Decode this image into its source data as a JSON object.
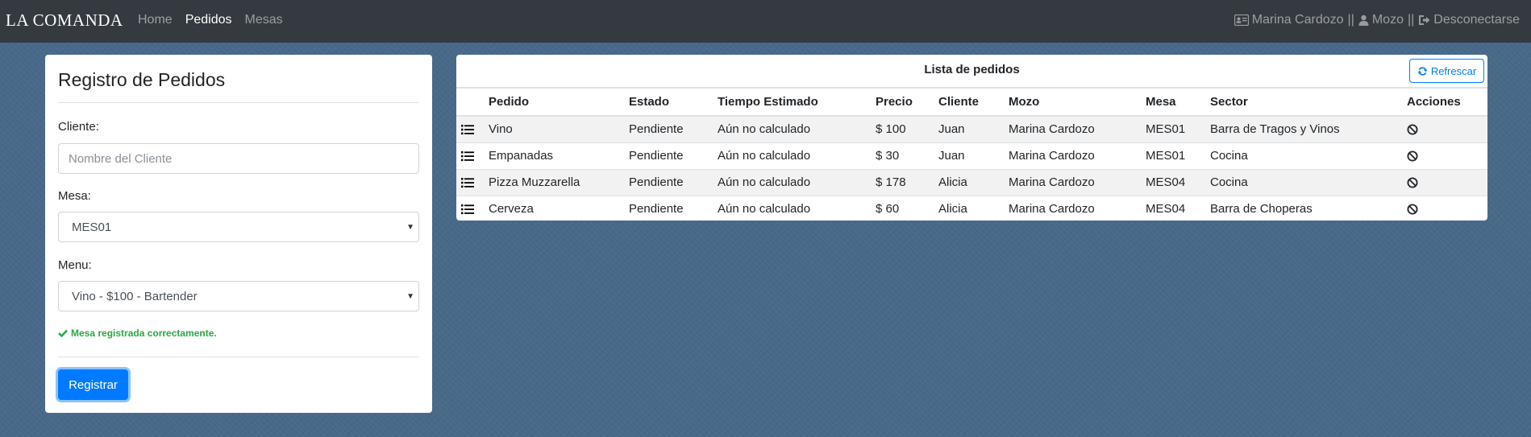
{
  "navbar": {
    "brand": "LA COMANDA",
    "links": [
      {
        "label": "Home",
        "active": false
      },
      {
        "label": "Pedidos",
        "active": true
      },
      {
        "label": "Mesas",
        "active": false
      }
    ],
    "user_name": "Marina Cardozo",
    "separator": "||",
    "role": "Mozo",
    "logout": "Desconectarse"
  },
  "form": {
    "title": "Registro de Pedidos",
    "cliente_label": "Cliente:",
    "cliente_placeholder": "Nombre del Cliente",
    "cliente_value": "",
    "mesa_label": "Mesa:",
    "mesa_value": "MES01",
    "menu_label": "Menu:",
    "menu_value": "Vino - $100 - Bartender",
    "success_message": "Mesa registrada correctamente.",
    "submit_label": "Registrar"
  },
  "orders": {
    "title": "Lista de pedidos",
    "refresh_label": "Refrescar",
    "headers": [
      "Pedido",
      "Estado",
      "Tiempo Estimado",
      "Precio",
      "Cliente",
      "Mozo",
      "Mesa",
      "Sector",
      "Acciones"
    ],
    "rows": [
      {
        "pedido": "Vino",
        "estado": "Pendiente",
        "tiempo": "Aún no calculado",
        "precio": "$ 100",
        "cliente": "Juan",
        "mozo": "Marina Cardozo",
        "mesa": "MES01",
        "sector": "Barra de Tragos y Vinos"
      },
      {
        "pedido": "Empanadas",
        "estado": "Pendiente",
        "tiempo": "Aún no calculado",
        "precio": "$ 30",
        "cliente": "Juan",
        "mozo": "Marina Cardozo",
        "mesa": "MES01",
        "sector": "Cocina"
      },
      {
        "pedido": "Pizza Muzzarella",
        "estado": "Pendiente",
        "tiempo": "Aún no calculado",
        "precio": "$ 178",
        "cliente": "Alicia",
        "mozo": "Marina Cardozo",
        "mesa": "MES04",
        "sector": "Cocina"
      },
      {
        "pedido": "Cerveza",
        "estado": "Pendiente",
        "tiempo": "Aún no calculado",
        "precio": "$ 60",
        "cliente": "Alicia",
        "mozo": "Marina Cardozo",
        "mesa": "MES04",
        "sector": "Barra de Choperas"
      }
    ]
  },
  "colors": {
    "navbar_bg": "#343a40",
    "primary": "#007bff",
    "success": "#28a745",
    "page_bg": "#48698a"
  },
  "icons": {
    "row_icon": "list-icon",
    "action_icon": "ban-icon",
    "user_icon": "id-card-icon",
    "role_icon": "user-icon",
    "logout_icon": "sign-out-icon",
    "refresh_icon": "refresh-icon",
    "success_icon": "check-icon"
  }
}
